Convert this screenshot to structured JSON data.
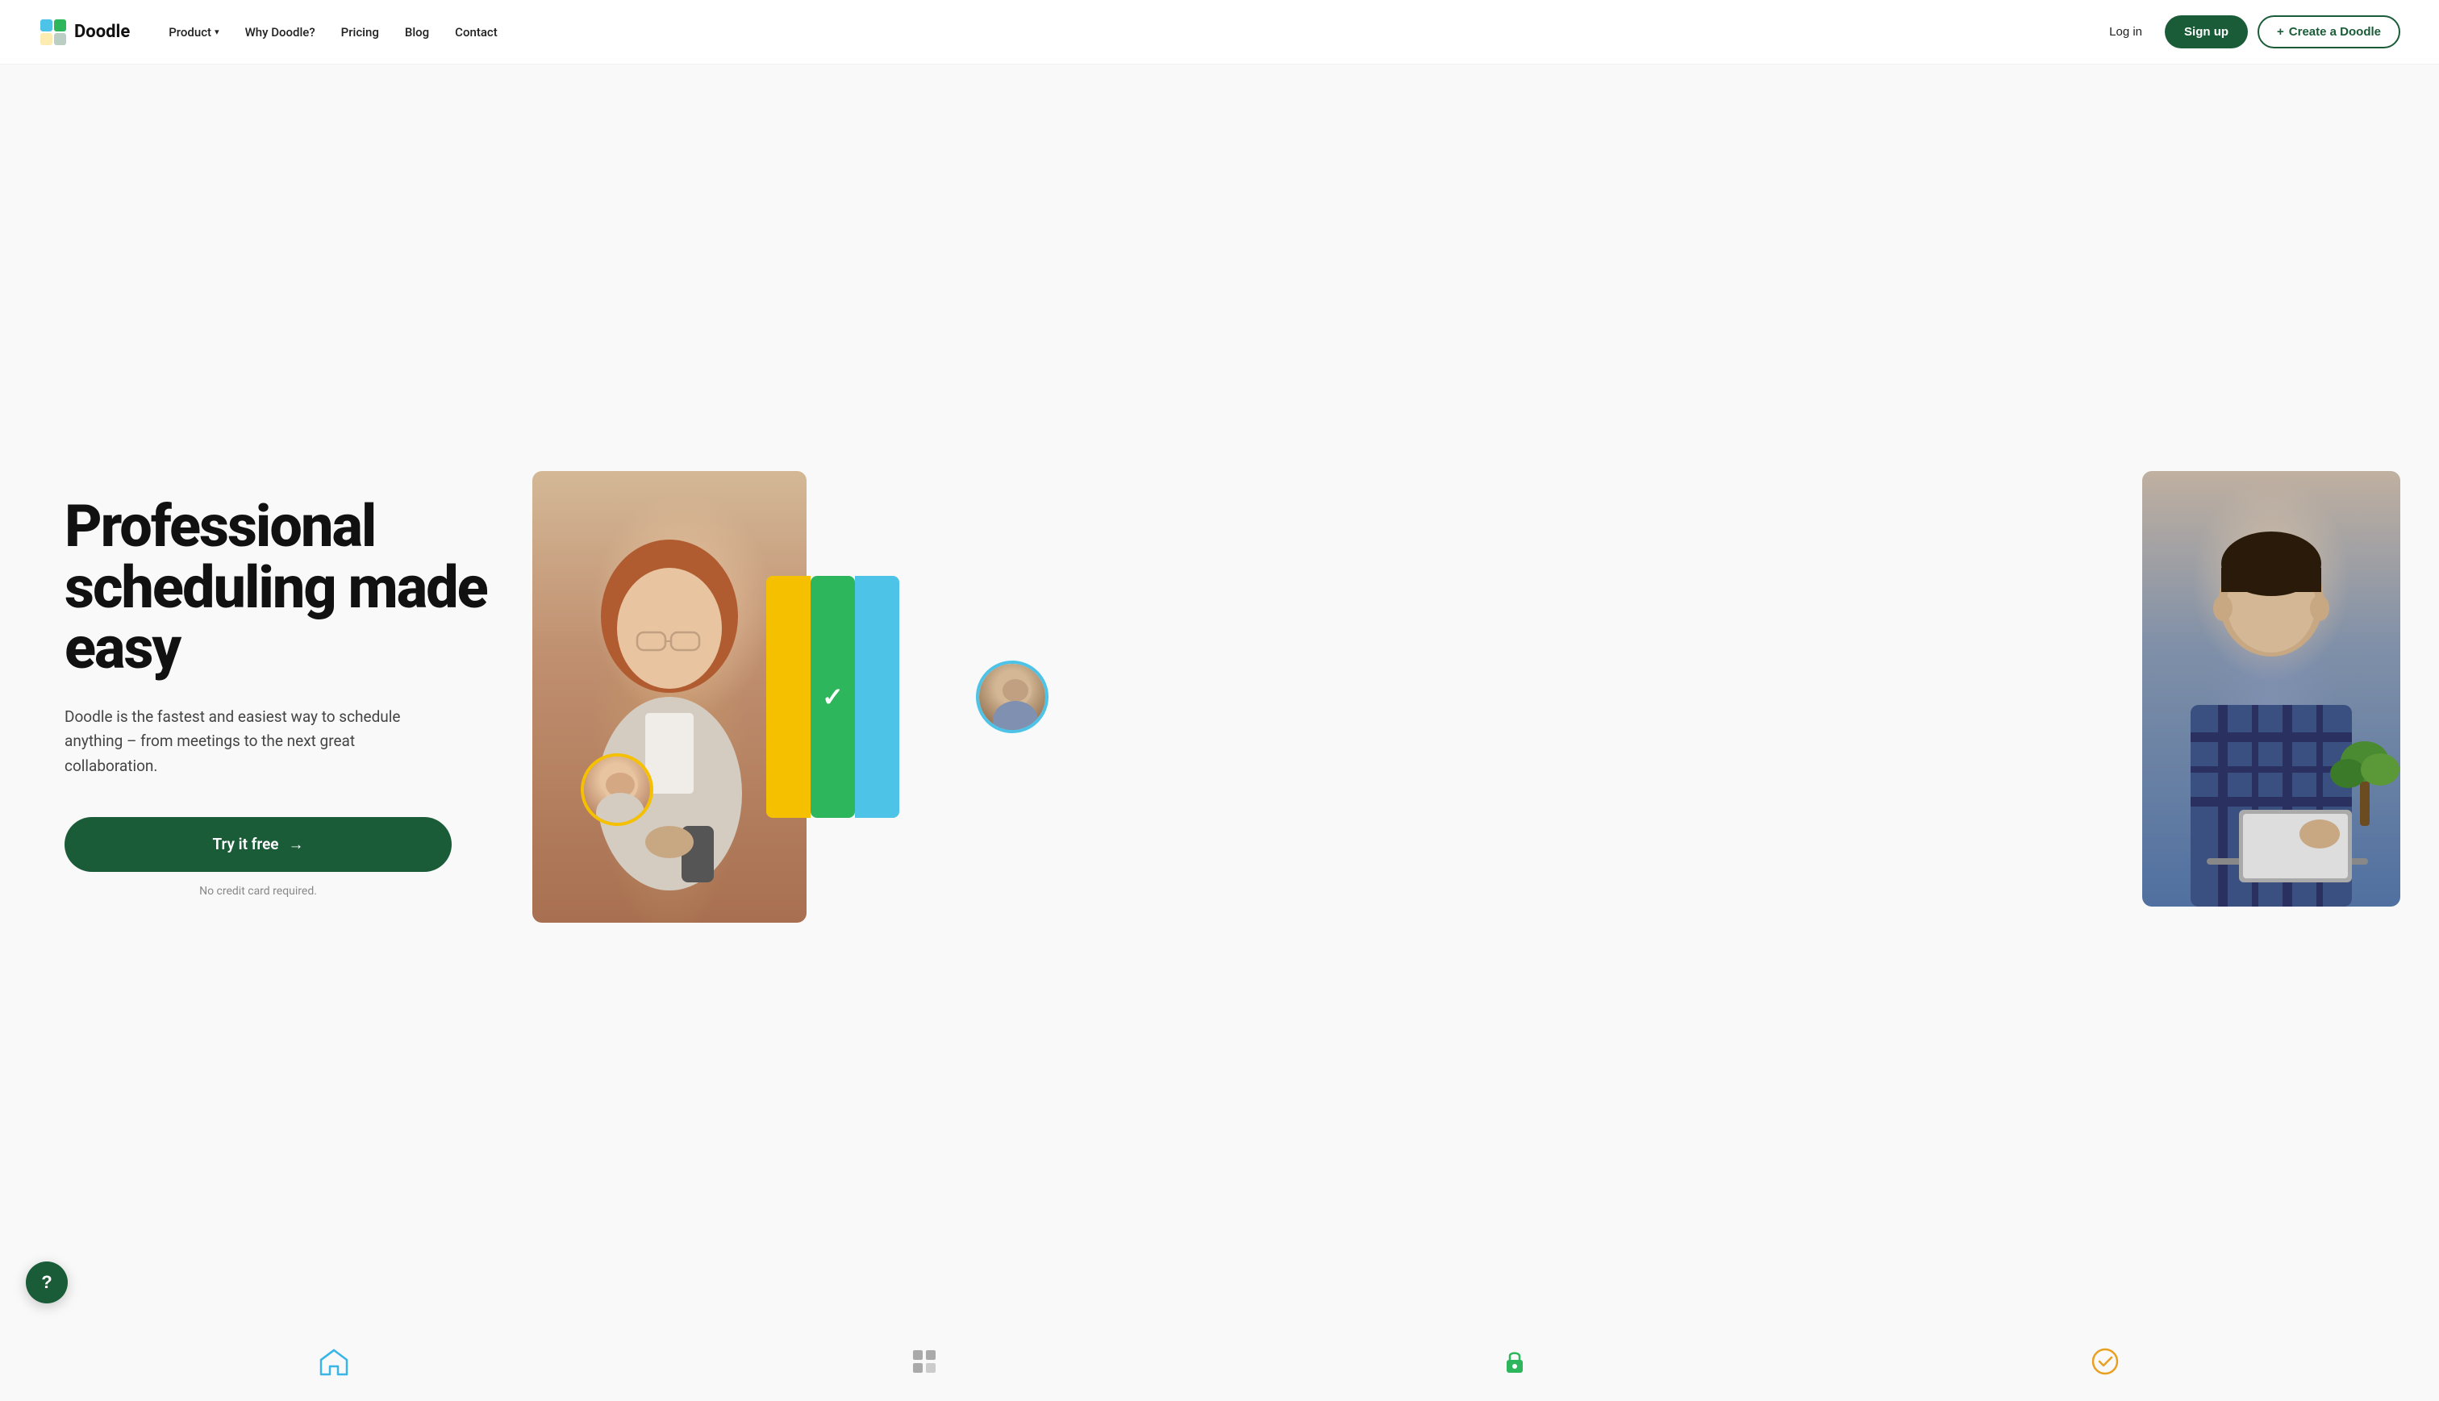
{
  "nav": {
    "logo_text": "Doodle",
    "links": [
      {
        "id": "product",
        "label": "Product",
        "has_chevron": true
      },
      {
        "id": "why-doodle",
        "label": "Why Doodle?",
        "has_chevron": false
      },
      {
        "id": "pricing",
        "label": "Pricing",
        "has_chevron": false
      },
      {
        "id": "blog",
        "label": "Blog",
        "has_chevron": false
      },
      {
        "id": "contact",
        "label": "Contact",
        "has_chevron": false
      }
    ],
    "login_label": "Log in",
    "signup_label": "Sign up",
    "create_label": "Create a Doodle",
    "create_prefix": "+"
  },
  "hero": {
    "title": "Professional scheduling made easy",
    "subtitle": "Doodle is the fastest and easiest way to schedule anything – from meetings to the next great collaboration.",
    "cta_label": "Try it free",
    "cta_arrow": "→",
    "no_cc": "No credit card required."
  },
  "features": [
    {
      "id": "house",
      "icon": "🏠",
      "color": "#3ab5e8"
    },
    {
      "id": "grid",
      "icon": "⊞",
      "color": "#aaaaaa"
    },
    {
      "id": "lock",
      "icon": "🔒",
      "color": "#2db65c"
    },
    {
      "id": "check-circle",
      "icon": "✓",
      "color": "#e8a020"
    }
  ],
  "help": {
    "label": "?"
  },
  "colors": {
    "primary": "#1a5c38",
    "yellow": "#f5c000",
    "green": "#2db65c",
    "blue": "#4dc3e8"
  }
}
